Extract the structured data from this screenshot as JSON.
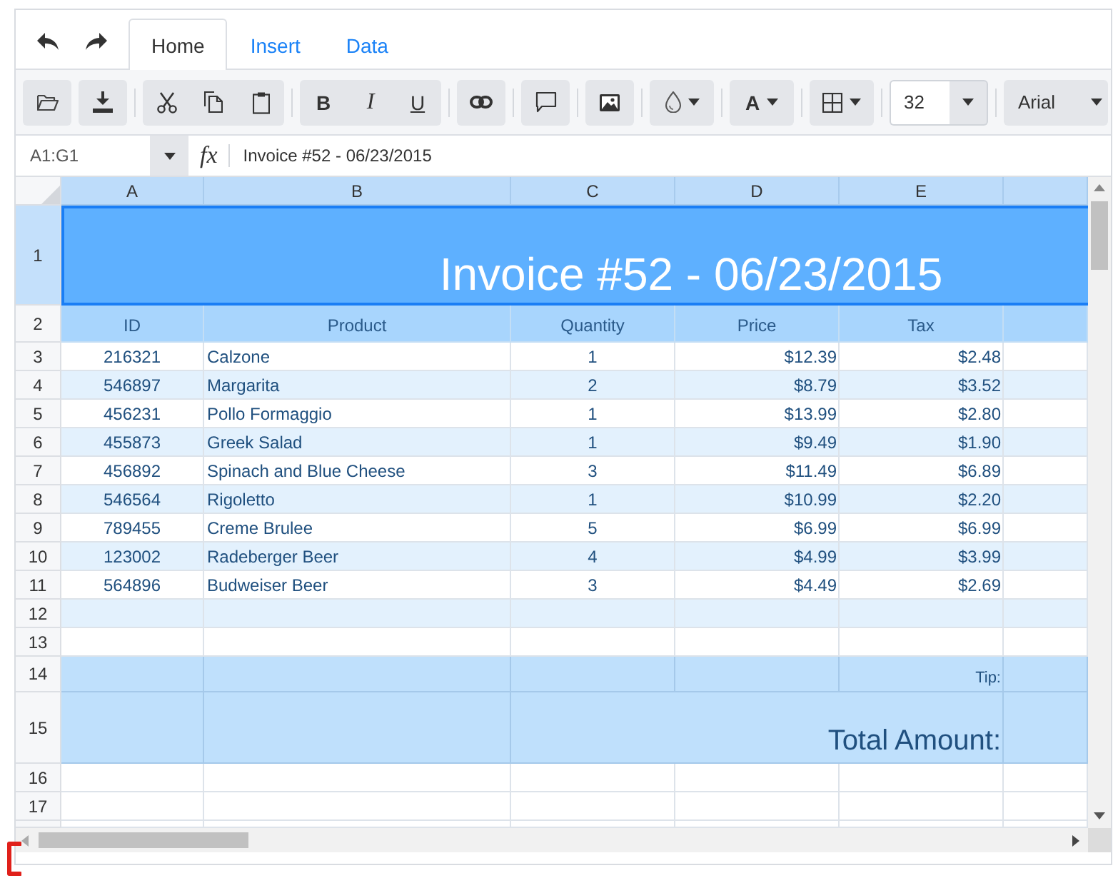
{
  "tabs": [
    {
      "label": "Home",
      "selected": true
    },
    {
      "label": "Insert",
      "selected": false
    },
    {
      "label": "Data",
      "selected": false
    }
  ],
  "toolbar": {
    "style_buttons": [
      "B",
      "I",
      "U"
    ],
    "font_color_label": "A",
    "font_size": "32",
    "font_family": "Arial"
  },
  "formula_bar": {
    "name_box": "A1:G1",
    "fx_label": "fx",
    "formula": "Invoice #52 - 06/23/2015"
  },
  "sheet": {
    "columns": [
      {
        "label": "A",
        "selected": true
      },
      {
        "label": "B",
        "selected": true
      },
      {
        "label": "C",
        "selected": true
      },
      {
        "label": "D",
        "selected": true
      },
      {
        "label": "E",
        "selected": true
      }
    ],
    "rows": [
      {
        "kind": "title",
        "number": "1",
        "text": "Invoice #52 - 06/23/2015",
        "selected": true
      },
      {
        "kind": "header",
        "number": "2",
        "cells": [
          "ID",
          "Product",
          "Quantity",
          "Price",
          "Tax"
        ]
      },
      {
        "kind": "item",
        "number": "3",
        "shaded": false,
        "cells": [
          "216321",
          "Calzone",
          "1",
          "$12.39",
          "$2.48"
        ]
      },
      {
        "kind": "item",
        "number": "4",
        "shaded": true,
        "cells": [
          "546897",
          "Margarita",
          "2",
          "$8.79",
          "$3.52"
        ]
      },
      {
        "kind": "item",
        "number": "5",
        "shaded": false,
        "cells": [
          "456231",
          "Pollo Formaggio",
          "1",
          "$13.99",
          "$2.80"
        ]
      },
      {
        "kind": "item",
        "number": "6",
        "shaded": true,
        "cells": [
          "455873",
          "Greek Salad",
          "1",
          "$9.49",
          "$1.90"
        ]
      },
      {
        "kind": "item",
        "number": "7",
        "shaded": false,
        "cells": [
          "456892",
          "Spinach and Blue Cheese",
          "3",
          "$11.49",
          "$6.89"
        ]
      },
      {
        "kind": "item",
        "number": "8",
        "shaded": true,
        "cells": [
          "546564",
          "Rigoletto",
          "1",
          "$10.99",
          "$2.20"
        ]
      },
      {
        "kind": "item",
        "number": "9",
        "shaded": false,
        "cells": [
          "789455",
          "Creme Brulee",
          "5",
          "$6.99",
          "$6.99"
        ]
      },
      {
        "kind": "item",
        "number": "10",
        "shaded": true,
        "cells": [
          "123002",
          "Radeberger Beer",
          "4",
          "$4.99",
          "$3.99"
        ]
      },
      {
        "kind": "item",
        "number": "11",
        "shaded": false,
        "cells": [
          "564896",
          "Budweiser Beer",
          "3",
          "$4.49",
          "$2.69"
        ]
      },
      {
        "kind": "blank",
        "number": "12",
        "shaded": true
      },
      {
        "kind": "blank",
        "number": "13",
        "shaded": false
      },
      {
        "kind": "tip",
        "number": "14",
        "label": "Tip:"
      },
      {
        "kind": "total",
        "number": "15",
        "label": "Total Amount:"
      },
      {
        "kind": "blank",
        "number": "16",
        "shaded": false
      },
      {
        "kind": "blank",
        "number": "17",
        "shaded": false
      }
    ]
  }
}
